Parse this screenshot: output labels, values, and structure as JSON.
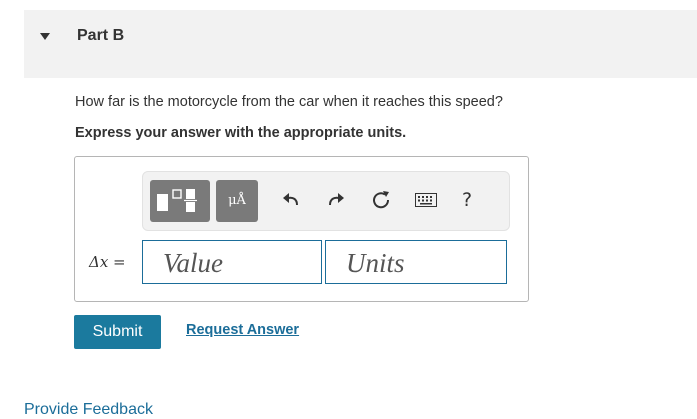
{
  "part": {
    "title": "Part B"
  },
  "question": "How far is the motorcycle from the car when it reaches this speed?",
  "instruction": "Express your answer with the appropriate units.",
  "toolbar": {
    "units_symbol": "μÅ",
    "help_label": "?",
    "icons": [
      "templates-icon",
      "units-icon",
      "undo-icon",
      "redo-icon",
      "reset-icon",
      "keyboard-icon",
      "help-icon"
    ]
  },
  "answer": {
    "variable_label": "Δx =",
    "value_placeholder": "Value",
    "units_placeholder": "Units"
  },
  "buttons": {
    "submit": "Submit",
    "request_answer": "Request Answer"
  },
  "feedback_link": "Provide Feedback",
  "colors": {
    "accent": "#1b7a9e",
    "link": "#1b6d99",
    "toolbar_button": "#7a7a7a",
    "header_bg": "#f2f2f2"
  }
}
